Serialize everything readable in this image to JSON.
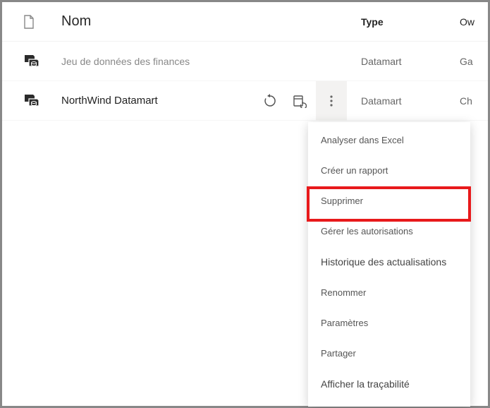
{
  "header": {
    "name": "Nom",
    "type": "Type",
    "owner": "Ow"
  },
  "rows": {
    "r0": {
      "name": "Jeu de données des finances",
      "type": "Datamart",
      "owner": "Ga"
    },
    "r1": {
      "name": "NorthWind Datamart",
      "type": "Datamart",
      "owner": "Ch"
    }
  },
  "menu": {
    "analyze": "Analyser dans Excel",
    "createReport": "Créer un rapport",
    "delete": "Supprimer",
    "managePermissions": "Gérer les autorisations",
    "refreshHistory": "Historique des actualisations",
    "rename": "Renommer",
    "settings": "Paramètres",
    "share": "Partager",
    "lineage": "Afficher la traçabilité"
  }
}
